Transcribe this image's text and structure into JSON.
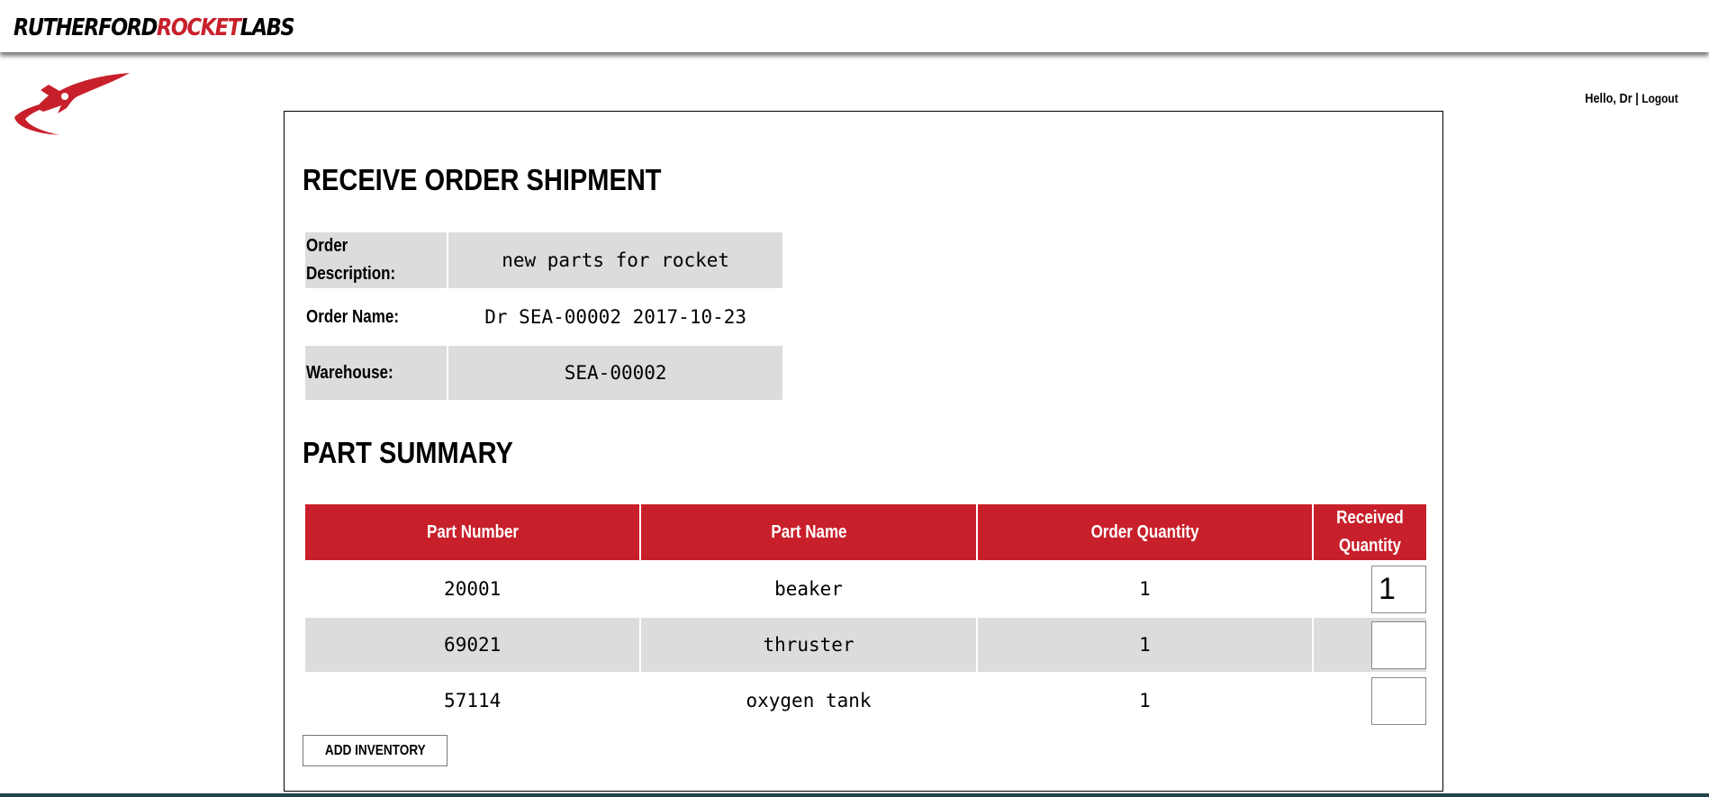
{
  "brand": {
    "part1": "RUTHERFORD",
    "part2": "ROCKET",
    "part3": "LABS",
    "icon": "rocket-logo"
  },
  "user": {
    "greeting": "Hello, Dr",
    "separator": " | ",
    "logout": "Logout"
  },
  "order": {
    "title": "RECEIVE ORDER SHIPMENT",
    "fields": [
      {
        "label": "Order Description:",
        "value": "new parts for rocket"
      },
      {
        "label": "Order Name:",
        "value": "Dr SEA-00002 2017-10-23"
      },
      {
        "label": "Warehouse:",
        "value": "SEA-00002"
      }
    ]
  },
  "summary": {
    "title": "PART SUMMARY",
    "columns": [
      "Part Number",
      "Part Name",
      "Order Quantity",
      "Received Quantity"
    ],
    "rows": [
      {
        "number": "20001",
        "name": "beaker",
        "order_qty": "1",
        "received": "1"
      },
      {
        "number": "69021",
        "name": "thruster",
        "order_qty": "1",
        "received": ""
      },
      {
        "number": "57114",
        "name": "oxygen tank",
        "order_qty": "1",
        "received": ""
      }
    ]
  },
  "add_button": "ADD INVENTORY",
  "colors": {
    "accent": "#c8202b",
    "row_shade": "#dcdcdc",
    "footer": "#21434a"
  }
}
